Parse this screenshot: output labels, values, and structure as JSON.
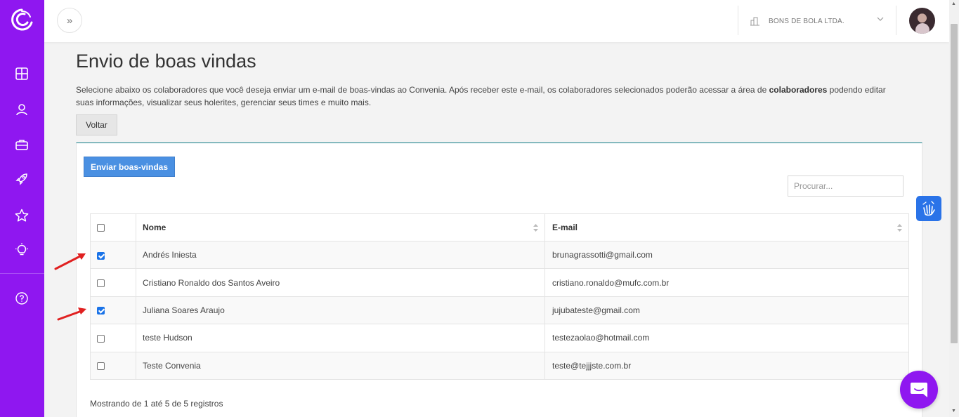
{
  "header": {
    "toggle_label": "»",
    "company_name": "BONS DE BOLA LTDA."
  },
  "page": {
    "title": "Envio de boas vindas",
    "description_part1": "Selecione abaixo os colaboradores que você deseja enviar um e-mail de boas-vindas ao Convenia. Após receber este e-mail, os colaboradores selecionados poderão acessar a área de ",
    "description_bold": "colaboradores",
    "description_part2": " podendo editar suas informações, visualizar seus holerites, gerenciar seus times e muito mais.",
    "back_label": "Voltar",
    "send_label": "Enviar boas-vindas",
    "search_placeholder": "Procurar...",
    "footer_info": "Mostrando de 1 até 5 de 5 registros"
  },
  "table": {
    "columns": [
      "Nome",
      "E-mail"
    ],
    "rows": [
      {
        "name": "Andrés Iniesta",
        "email": "brunagrassotti@gmail.com",
        "checked": true
      },
      {
        "name": "Cristiano Ronaldo dos Santos Aveiro",
        "email": "cristiano.ronaldo@mufc.com.br",
        "checked": false
      },
      {
        "name": "Juliana Soares Araujo",
        "email": "jujubateste@gmail.com",
        "checked": true
      },
      {
        "name": "teste Hudson",
        "email": "testezaolao@hotmail.com",
        "checked": false
      },
      {
        "name": "Teste Convenia",
        "email": "teste@tejjjste.com.br",
        "checked": false
      }
    ]
  },
  "sidebar": {
    "icons": [
      "dashboard-icon",
      "user-icon",
      "briefcase-icon",
      "rocket-icon",
      "star-icon",
      "lightbulb-icon",
      "help-icon"
    ]
  },
  "colors": {
    "sidebar": "#8f17f0",
    "primary_button": "#4a90e2",
    "accessibility": "#2a73e8",
    "annotation_arrow": "#e02020"
  }
}
